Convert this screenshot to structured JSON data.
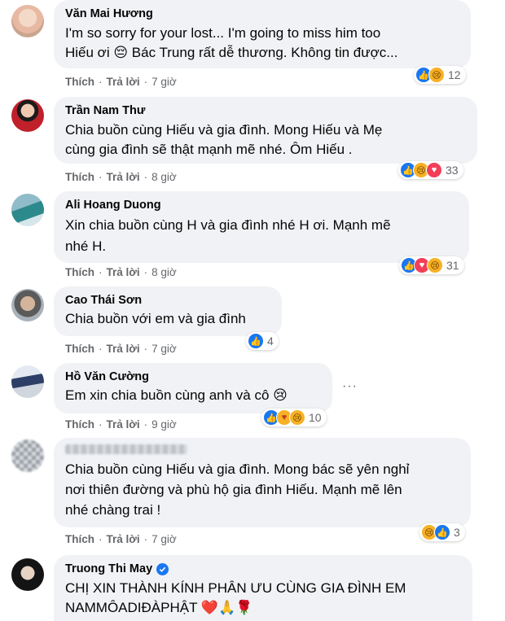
{
  "comments": [
    {
      "author": "Văn Mai Hương",
      "text": "I'm so sorry for your lost... I'm going to miss him too\nHiếu ơi 😔 Bác Trung rất dễ thương. Không tin được...",
      "like": "Thích",
      "reply": "Trả lời",
      "time": "7 giờ",
      "count": "12",
      "reactions": [
        "like",
        "sad"
      ]
    },
    {
      "author": "Trần Nam Thư",
      "text": "Chia buồn cùng Hiếu và gia đình. Mong Hiếu và Mẹ\ncùng gia đình sẽ thật mạnh mẽ nhé. Ôm Hiếu .",
      "like": "Thích",
      "reply": "Trả lời",
      "time": "8 giờ",
      "count": "33",
      "reactions": [
        "like",
        "sad",
        "love"
      ]
    },
    {
      "author": "Ali Hoang Duong",
      "text": "Xin chia buồn cùng H và gia đình nhé H ơi. Mạnh mẽ\nnhé H.",
      "like": "Thích",
      "reply": "Trả lời",
      "time": "8 giờ",
      "count": "31",
      "reactions": [
        "like",
        "love",
        "sad"
      ]
    },
    {
      "author": "Cao Thái Sơn",
      "text": "Chia buồn với em và gia đình",
      "like": "Thích",
      "reply": "Trả lời",
      "time": "7 giờ",
      "count": "4",
      "reactions": [
        "like"
      ]
    },
    {
      "author": "Hồ Văn Cường",
      "text": "Em xin chia buồn cùng anh và cô 😢",
      "like": "Thích",
      "reply": "Trả lời",
      "time": "9 giờ",
      "count": "10",
      "reactions": [
        "like",
        "care",
        "sad"
      ]
    },
    {
      "author": "",
      "text": "Chia buồn cùng Hiếu và gia đình. Mong bác sẽ yên nghỉ\nnơi thiên đường và phù hộ gia đình Hiếu. Mạnh mẽ lên\nnhé chàng trai !",
      "like": "Thích",
      "reply": "Trả lời",
      "time": "7 giờ",
      "count": "3",
      "reactions": [
        "sad",
        "like"
      ]
    },
    {
      "author": "Truong Thi May",
      "text": "CHỊ XIN THÀNH KÍNH PHÂN ƯU CÙNG GIA ĐÌNH EM\nNAMMÔADIĐÀPHẬT ❤️🙏🌹"
    }
  ],
  "more_options": "···",
  "sep": "·"
}
